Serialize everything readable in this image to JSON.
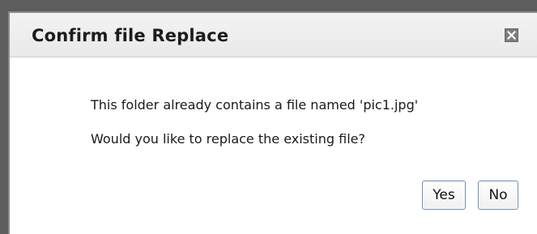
{
  "dialog": {
    "title": "Confirm file Replace",
    "close_icon": "close-icon",
    "message_line1": "This folder already contains a file named 'pic1.jpg'",
    "message_line2": "Would you like to replace the existing file?",
    "buttons": {
      "yes_label": "Yes",
      "no_label": "No"
    }
  },
  "colors": {
    "backdrop": "#5d5d5d",
    "titlebar": "#eeeeee",
    "close_button": "#7c7c7c",
    "button_border": "#6f8fb5"
  }
}
